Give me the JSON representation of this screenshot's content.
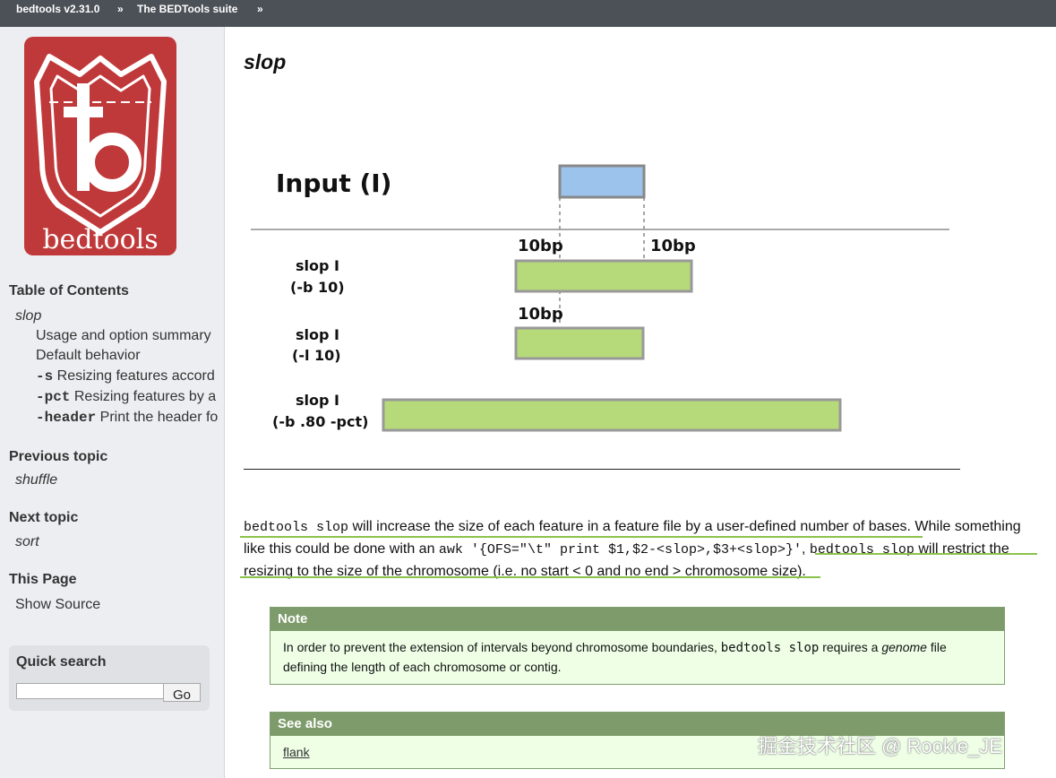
{
  "nav": {
    "home": "bedtools v2.31.0",
    "sep": "»",
    "suite": "The BEDTools suite"
  },
  "logo": {
    "text": "bedtools"
  },
  "sidebar": {
    "toc_title": "Table of Contents",
    "toc_root": "slop",
    "toc_items": [
      {
        "code": "",
        "text": "Usage and option summary"
      },
      {
        "code": "",
        "text": "Default behavior"
      },
      {
        "code": "-s",
        "text": "Resizing features accord"
      },
      {
        "code": "-pct",
        "text": "Resizing features by a"
      },
      {
        "code": "-header",
        "text": "Print the header fo"
      }
    ],
    "prev_title": "Previous topic",
    "prev_link": "shuffle",
    "next_title": "Next topic",
    "next_link": "sort",
    "page_title": "This Page",
    "show_source": "Show Source",
    "quick_search": "Quick search",
    "go": "Go"
  },
  "main": {
    "title": "slop",
    "diagram": {
      "input_label": "Input (I)",
      "left_10bp": "10bp",
      "right_10bp": "10bp",
      "left_10bp_2": "10bp",
      "row1_name": "slop I",
      "row1_opt": "(-b 10)",
      "row2_name": "slop I",
      "row2_opt": "(-l 10)",
      "row3_name": "slop I",
      "row3_opt": "(-b .80 -pct)"
    },
    "para": {
      "c1": "bedtools slop",
      "t1": " will increase the size of each feature in a feature file by a user-defined number of bases. While something like this could be done with an ",
      "c2": "awk '{OFS=\"\\t\" print $1,$2-<slop>,$3+<slop>}'",
      "t2": ", ",
      "c3": "bedtools slop",
      "t3": " will restrict the resizing to the size of the chromosome (i.e. no start < 0 and no end > chromosome size)."
    },
    "note": {
      "title": "Note",
      "t1": "In order to prevent the extension of intervals beyond chromosome boundaries, ",
      "code": "bedtools slop",
      "t2": " requires a ",
      "em": "genome",
      "t3": " file defining the length of each chromosome or contig."
    },
    "seealso": {
      "title": "See also",
      "link": "flank"
    }
  },
  "watermark": "掘金技术社区 @ Rookie_JE",
  "colors": {
    "topbar": "#4c5157",
    "sidebar": "#eceef1",
    "note_header": "#7e9c6b",
    "note_bg": "#eeffe6",
    "logo_red": "#c0393a",
    "input_blue": "#9cc3ec",
    "slop_green": "#b6d97a",
    "underline_green": "#8bc34a"
  }
}
